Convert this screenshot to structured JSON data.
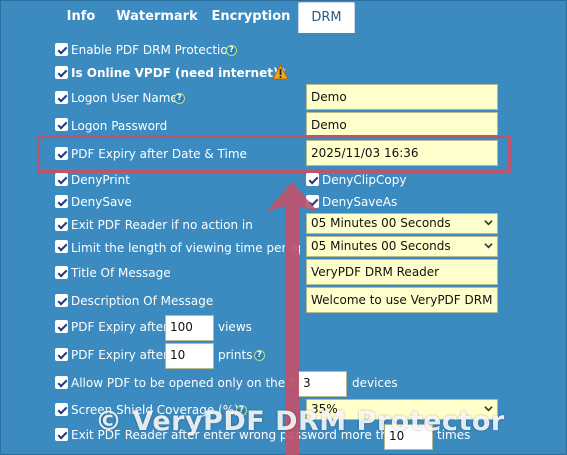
{
  "tabs": [
    {
      "label": "Info",
      "active": false
    },
    {
      "label": "Watermark",
      "active": false
    },
    {
      "label": "Encryption",
      "active": false
    },
    {
      "label": "DRM",
      "active": true
    }
  ],
  "options": {
    "enable_drm": "Enable PDF DRM Protection",
    "online_vpdf": "Is Online VPDF (need internet)?",
    "logon_user": "Logon User Name",
    "logon_password": "Logon Password",
    "expiry_date": "PDF Expiry after Date & Time",
    "deny_print": "DenyPrint",
    "deny_clipcopy": "DenyClipCopy",
    "deny_save": "DenySave",
    "deny_saveas": "DenySaveAs",
    "exit_no_action": "Exit PDF Reader if no action in",
    "limit_viewing": "Limit the length of viewing time per open",
    "title_message": "Title Of Message",
    "description_message": "Description Of Message",
    "expiry_views_prefix": "PDF Expiry after",
    "expiry_views_suffix": "views",
    "expiry_prints_prefix": "PDF Expiry after",
    "expiry_prints_suffix": "prints",
    "devices_prefix": "Allow PDF to be opened only on the first",
    "devices_suffix": "devices",
    "screen_shield": "Screen Shield Coverage (%):",
    "exit_wrong_password_prefix": "Exit PDF Reader after enter wrong password more than",
    "exit_wrong_password_suffix": "times"
  },
  "values": {
    "logon_user": "Demo",
    "logon_password": "Demo",
    "expiry_date": "2025/11/03 16:36",
    "exit_no_action": "05 Minutes 00 Seconds",
    "limit_viewing": "05 Minutes 00 Seconds",
    "title_message": "VeryPDF DRM Reader",
    "description_message": "Welcome to use VeryPDF DRM Reader",
    "expiry_views": "100",
    "expiry_prints": "10",
    "devices": "3",
    "screen_shield": "35%",
    "wrong_password": "10"
  },
  "help_glyph": "?",
  "watermark": "© VeryPDF DRM Protector",
  "colors": {
    "background": "#3b8ac0",
    "field": "#ffffcc",
    "highlight": "#c0536c",
    "warning": "#f5a623"
  }
}
